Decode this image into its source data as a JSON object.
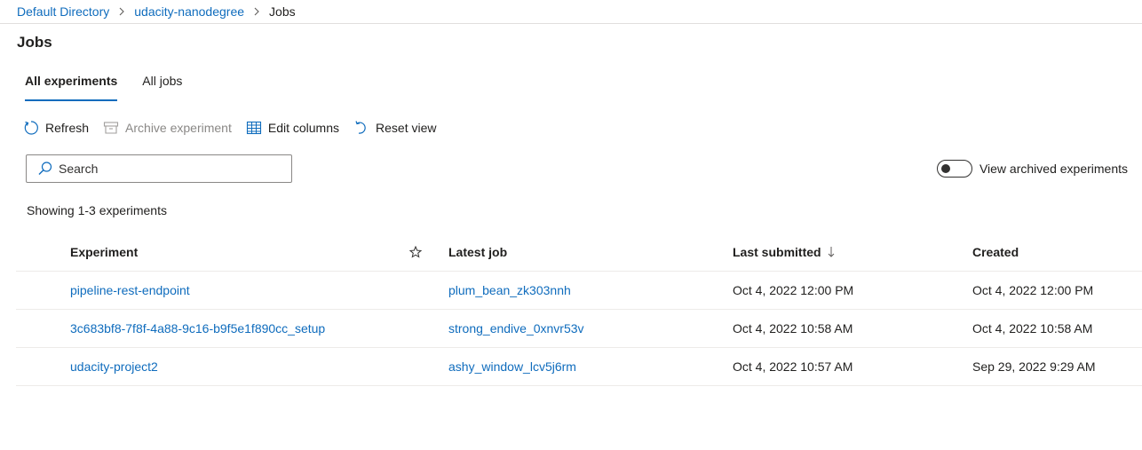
{
  "breadcrumb": {
    "items": [
      "Default Directory",
      "udacity-nanodegree"
    ],
    "current": "Jobs"
  },
  "page": {
    "title": "Jobs"
  },
  "tabs": [
    {
      "label": "All experiments",
      "active": true
    },
    {
      "label": "All jobs",
      "active": false
    }
  ],
  "toolbar": {
    "refresh": "Refresh",
    "archive": "Archive experiment",
    "edit_columns": "Edit columns",
    "reset_view": "Reset view"
  },
  "search": {
    "placeholder": "Search",
    "value": ""
  },
  "archived_toggle": {
    "label": "View archived experiments",
    "on": false
  },
  "count_text": "Showing 1-3 experiments",
  "table": {
    "columns": {
      "experiment": "Experiment",
      "latest_job": "Latest job",
      "last_submitted": "Last submitted",
      "created": "Created"
    },
    "rows": [
      {
        "experiment": "pipeline-rest-endpoint",
        "latest_job": "plum_bean_zk303nnh",
        "last_submitted": "Oct 4, 2022 12:00 PM",
        "created": "Oct 4, 2022 12:00 PM"
      },
      {
        "experiment": "3c683bf8-7f8f-4a88-9c16-b9f5e1f890cc_setup",
        "latest_job": "strong_endive_0xnvr53v",
        "last_submitted": "Oct 4, 2022 10:58 AM",
        "created": "Oct 4, 2022 10:58 AM"
      },
      {
        "experiment": "udacity-project2",
        "latest_job": "ashy_window_lcv5j6rm",
        "last_submitted": "Oct 4, 2022 10:57 AM",
        "created": "Sep 29, 2022 9:29 AM"
      }
    ]
  },
  "colors": {
    "accent": "#0f6cbd",
    "text": "#201f1e",
    "disabled": "#8a8886",
    "divider": "#edebe9"
  }
}
